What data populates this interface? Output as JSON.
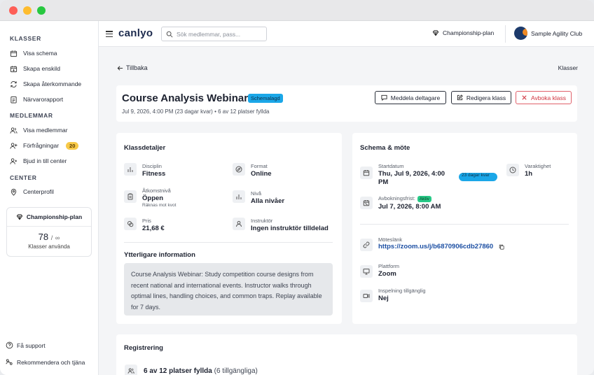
{
  "sidebar": {
    "sections": {
      "classes": "KLASSER",
      "members": "MEDLEMMAR",
      "center": "CENTER"
    },
    "items": [
      {
        "label": "Visa schema",
        "icon": "calendar-icon"
      },
      {
        "label": "Skapa enskild",
        "icon": "calendar-plus-icon"
      },
      {
        "label": "Skapa återkommande",
        "icon": "repeat-icon"
      },
      {
        "label": "Närvarorapport",
        "icon": "report-icon"
      },
      {
        "label": "Visa medlemmar",
        "icon": "users-icon"
      },
      {
        "label": "Förfrågningar",
        "icon": "user-plus-icon",
        "badge": "20"
      },
      {
        "label": "Bjud in till center",
        "icon": "user-invite-icon"
      },
      {
        "label": "Centerprofil",
        "icon": "location-icon"
      }
    ],
    "plan": {
      "name": "Championship-plan",
      "used": "78",
      "limit": "∞",
      "used_label": "Klasser använda"
    },
    "footer": {
      "support": "Få support",
      "refer": "Rekommendera och tjäna"
    }
  },
  "topbar": {
    "logo": "canlyo",
    "search_placeholder": "Sök medlemmar, pass...",
    "plan_label": "Championship-plan",
    "club_name": "Sample Agility Club"
  },
  "nav": {
    "back": "Tillbaka",
    "breadcrumb": "Klasser"
  },
  "class": {
    "title": "Course Analysis Webinar",
    "status": "Schemalagd",
    "meta": "Jul 9, 2026, 4:00 PM (23 dagar kvar)  •  6 av 12 platser fyllda",
    "buttons": {
      "message": "Meddela deltagare",
      "edit": "Redigera klass",
      "cancel": "Avboka klass"
    }
  },
  "details": {
    "title": "Klassdetaljer",
    "discipline": {
      "label": "Disciplin",
      "value": "Fitness"
    },
    "format": {
      "label": "Format",
      "value": "Online"
    },
    "access": {
      "label": "Åtkomstnivå",
      "value": "Öppen",
      "note": "Räknas mot kvot"
    },
    "level": {
      "label": "Nivå",
      "value": "Alla nivåer"
    },
    "price": {
      "label": "Pris",
      "value": "21,68 €"
    },
    "instructor": {
      "label": "Instruktör",
      "value": "Ingen instruktör tilldelad"
    },
    "extra_title": "Ytterligare information",
    "extra_text": "Course Analysis Webinar: Study competition course designs from recent national and international events. Instructor walks through optimal lines, handling choices, and common traps. Replay available for 7 days."
  },
  "schedule": {
    "title": "Schema & möte",
    "start": {
      "label": "Startdatum",
      "value": "Thu, Jul 9, 2026, 4:00 PM",
      "days_left": "23 dagar kvar"
    },
    "duration": {
      "label": "Varaktighet",
      "value": "1h"
    },
    "cancel_deadline": {
      "label": "Avbokningsfrist:",
      "status": "Aktiv",
      "value": "Jul 7, 2026, 8:00 AM"
    },
    "meeting_link": {
      "label": "Möteslänk",
      "value": "https://zoom.us/j/b6870906cdb27860"
    },
    "platform": {
      "label": "Plattform",
      "value": "Zoom"
    },
    "recording": {
      "label": "Inspelning tillgänglig",
      "value": "Nej"
    }
  },
  "registration": {
    "title": "Registrering",
    "filled": "6 av 12 platser fyllda",
    "available": "(6 tillgängliga)"
  }
}
